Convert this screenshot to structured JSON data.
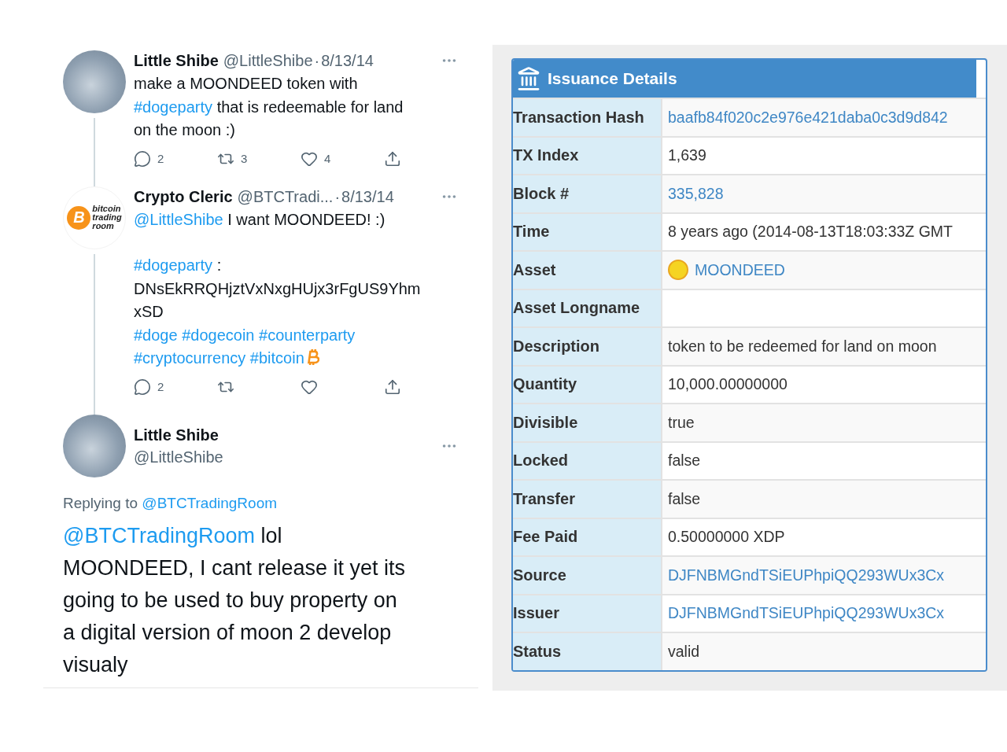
{
  "thread": [
    {
      "kind": "compact",
      "avatar": {
        "kind": "photo"
      },
      "author": {
        "name": "Little Shibe",
        "handle": "@LittleShibe",
        "separator": "·",
        "date": "8/13/14"
      },
      "paragraphs": [
        [
          [
            {
              "kind": "text",
              "text": "make a MOONDEED token with"
            }
          ],
          [
            {
              "kind": "link",
              "text": "#dogeparty"
            },
            {
              "kind": "text",
              "text": " that is redeemable for land"
            }
          ],
          [
            {
              "kind": "text",
              "text": "on the moon :)"
            }
          ]
        ]
      ],
      "actions": [
        {
          "kind": "reply",
          "count": "2"
        },
        {
          "kind": "retweet",
          "count": "3"
        },
        {
          "kind": "like",
          "count": "4"
        },
        {
          "kind": "share"
        }
      ]
    },
    {
      "kind": "compact",
      "avatar": {
        "kind": "logo",
        "mark": "B",
        "words": [
          "bitcoin",
          "trading",
          "room"
        ]
      },
      "author": {
        "name": "Crypto Cleric",
        "handle": "@BTCTradi...",
        "separator": "·",
        "date": "8/13/14"
      },
      "paragraphs": [
        [
          [
            {
              "kind": "link",
              "text": "@LittleShibe"
            },
            {
              "kind": "text",
              "text": " I want MOONDEED! :)"
            }
          ]
        ],
        [
          [
            {
              "kind": "link",
              "text": "#dogeparty"
            },
            {
              "kind": "text",
              "text": " :"
            }
          ],
          [
            {
              "kind": "text",
              "text": "DNsEkRRQHjztVxNxgHUjx3rFgUS9Yhm"
            }
          ],
          [
            {
              "kind": "text",
              "text": "xSD"
            }
          ],
          [
            {
              "kind": "link",
              "text": "#doge"
            },
            {
              "kind": "link",
              "text": "#dogecoin"
            },
            {
              "kind": "link",
              "text": "#counterparty"
            }
          ],
          [
            {
              "kind": "link",
              "text": "#cryptocurrency"
            },
            {
              "kind": "link",
              "text": "#bitcoin"
            },
            {
              "kind": "icon"
            }
          ]
        ]
      ],
      "actions": [
        {
          "kind": "reply",
          "count": "2"
        },
        {
          "kind": "retweet"
        },
        {
          "kind": "like"
        },
        {
          "kind": "share"
        }
      ]
    },
    {
      "kind": "focused",
      "avatar": {
        "kind": "photo"
      },
      "author": {
        "name": "Little Shibe",
        "handle": "@LittleShibe"
      },
      "replying": {
        "label": "Replying to",
        "handle": "@BTCTradingRoom"
      },
      "paragraphs": [
        [
          [
            {
              "kind": "link",
              "text": "@BTCTradingRoom"
            },
            {
              "kind": "text",
              "text": " lol"
            }
          ],
          [
            {
              "kind": "text",
              "text": "MOONDEED, I cant release it yet its"
            }
          ],
          [
            {
              "kind": "text",
              "text": "going to be used to buy property on"
            }
          ],
          [
            {
              "kind": "text",
              "text": "a digital version of moon 2 develop"
            }
          ],
          [
            {
              "kind": "text",
              "text": "visualy"
            }
          ]
        ]
      ]
    }
  ],
  "issuance": {
    "title": "Issuance Details",
    "rows": [
      {
        "label": "Transaction Hash",
        "kind": "link",
        "value": "baafb84f020c2e976e421daba0c3d9d842"
      },
      {
        "label": "TX Index",
        "kind": "text",
        "value": "1,639"
      },
      {
        "label": "Block #",
        "kind": "link",
        "value": "335,828"
      },
      {
        "label": "Time",
        "kind": "text",
        "value": "8 years ago (2014-08-13T18:03:33Z GMT"
      },
      {
        "label": "Asset",
        "kind": "asset",
        "value": "MOONDEED"
      },
      {
        "label": "Asset Longname",
        "kind": "empty"
      },
      {
        "label": "Description",
        "kind": "text",
        "value": "token to be redeemed for land on moon"
      },
      {
        "label": "Quantity",
        "kind": "text",
        "value": "10,000.00000000"
      },
      {
        "label": "Divisible",
        "kind": "text",
        "value": "true"
      },
      {
        "label": "Locked",
        "kind": "text",
        "value": "false"
      },
      {
        "label": "Transfer",
        "kind": "text",
        "value": "false"
      },
      {
        "label": "Fee Paid",
        "kind": "text",
        "value": "0.50000000 XDP"
      },
      {
        "label": "Source",
        "kind": "link",
        "value": "DJFNBMGndTSiEUPhpiQQ293WUx3Cx"
      },
      {
        "label": "Issuer",
        "kind": "link",
        "value": "DJFNBMGndTSiEUPhpiQQ293WUx3Cx"
      },
      {
        "label": "Status",
        "kind": "text",
        "value": "valid"
      }
    ]
  }
}
